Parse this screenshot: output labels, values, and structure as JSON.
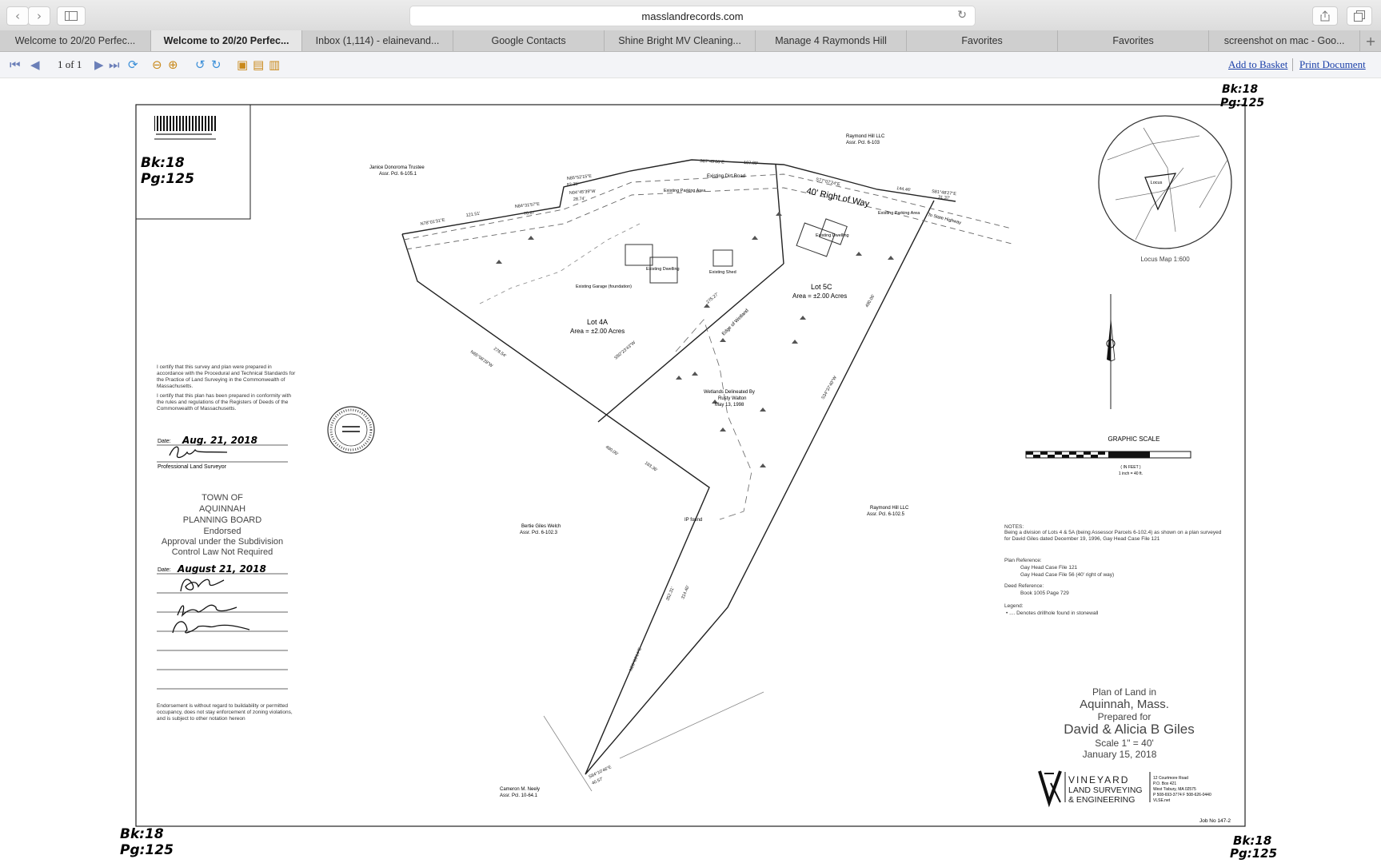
{
  "browser": {
    "url": "masslandrecords.com",
    "tabs": [
      {
        "label": "Welcome to 20/20 Perfec...",
        "active": false
      },
      {
        "label": "Welcome to 20/20 Perfec...",
        "active": true
      },
      {
        "label": "Inbox (1,114) - elainevand...",
        "active": false
      },
      {
        "label": "Google Contacts",
        "active": false
      },
      {
        "label": "Shine Bright MV Cleaning...",
        "active": false
      },
      {
        "label": "Manage 4 Raymonds Hill",
        "active": false
      },
      {
        "label": "Favorites",
        "active": false
      },
      {
        "label": "Favorites",
        "active": false
      },
      {
        "label": "screenshot on mac - Goo...",
        "active": false
      }
    ],
    "new_tab": "+"
  },
  "viewer": {
    "page_indicator": "1 of 1",
    "add_to_basket": "Add to Basket",
    "print_document": "Print Document"
  },
  "plan": {
    "stamps": {
      "top_right": [
        "Bk:18",
        "Pg:125"
      ],
      "title_block": [
        "Bk:18",
        "Pg:125"
      ],
      "bottom_left": [
        "Bk:18",
        "Pg:125"
      ],
      "bottom_right": [
        "Bk:18",
        "Pg:125"
      ]
    },
    "lots": {
      "lot4a_name": "Lot 4A",
      "lot4a_area": "Area = ±2.00 Acres",
      "lot5c_name": "Lot 5C",
      "lot5c_area": "Area = ±2.00 Acres"
    },
    "labels": {
      "right_of_way": "40' Right of Way",
      "dirt_road": "Existing Dirt Road",
      "state_highway": "To State Highway",
      "janice": "Janice Donoroma Trustee",
      "janice_parcel": "Assr. Pcl. 6-105.1",
      "raymond_top": "Raymond Hill LLC",
      "raymond_top_parcel": "Assr. Pcl. 6-103",
      "raymond_right": "Raymond Hill LLC",
      "raymond_right_parcel": "Assr. Pcl. 6-102.5",
      "bertie": "Bertie Giles Welch",
      "bertie_parcel": "Assr. Pcl. 6-102.3",
      "cameron": "Cameron M. Neely",
      "cameron_parcel": "Assr. Pcl. 10-64.1",
      "wetlands": "Wetlands Delineated By",
      "wetlands2": "Rusty Walton",
      "wetlands3": "May 13, 1998",
      "existing_dwelling": "Existing Dwelling",
      "existing_garage": "Existing Garage (foundation)",
      "existing_shed": "Existing Shed",
      "parking": "Existing Parking Area",
      "ip_found": "IP found",
      "edge_wetlands": "Edge of Wetland"
    },
    "certification": {
      "cert1": "I certify that this survey and plan were prepared in accordance with the Procedural and Technical Standards for the Practice of Land Surveying in the Commonwealth of Massachusetts.",
      "cert2": "I certify that this plan has been prepared in conformity with the rules and regulations of the Registers of Deeds of the Commonwealth of Massachusetts.",
      "date_label": "Date:",
      "date_value": "Aug. 21, 2018",
      "surveyor_label": "Professional Land Surveyor"
    },
    "planning_board": {
      "lines": [
        "TOWN OF",
        "AQUINNAH",
        "PLANNING BOARD",
        "Endorsed",
        "Approval under the Subdivision",
        "Control Law Not Required"
      ],
      "date_label": "Date:",
      "date_value": "August 21, 2018",
      "endorsement_note": "Endorsement is without regard to buildability or permitted occupancy, does not stay enforcement of zoning violations, and is subject to other notation hereon"
    },
    "locus": {
      "label": "Locus Map   1:600",
      "inner": "Locus"
    },
    "graphic_scale": {
      "title": "GRAPHIC SCALE",
      "sub1": "( IN FEET )",
      "sub2": "1 inch = 40 ft."
    },
    "notes": {
      "heading": "NOTES:",
      "text": "Being a division of Lots 4 & 5A (being Assessor Parcels 6-102.4) as shown on a plan surveyed for David Giles dated December 19, 1996, Gay Head Case File 121",
      "plan_ref": "Plan Reference:",
      "plan_ref1": "Gay Head Case File 121",
      "plan_ref2": "Gay Head Case File 56 (40' right of way)",
      "deed_ref": "Deed Reference:",
      "deed_ref1": "Book 1005 Page 729",
      "legend": "Legend:",
      "legend1": "• .... Denotes drillhole found in stonewall"
    },
    "title_block": {
      "line1": "Plan of Land in",
      "line2": "Aquinnah, Mass.",
      "line3": "Prepared for",
      "line4": "David & Alicia B Giles",
      "line5": "Scale 1\" = 40'",
      "line6": "January 15, 2018"
    },
    "firm": {
      "name1": "VINEYARD",
      "name2": "LAND SURVEYING",
      "name3": "& ENGINEERING",
      "address1": "12 Courtmore Road",
      "address2": "P.O. Box 421",
      "address3": "West Tisbury, MA 02575",
      "address4": "P 508-693-3774  F 508-626-0440",
      "address5": "VLSE.net"
    },
    "job_no": "Job No 147-2",
    "bearings": [
      "N78°01'31\"E",
      "121.51'",
      "N84°31'57\"E",
      "76.67'",
      "N85°52'15\"E",
      "82.35'",
      "N04°45'39\"W",
      "28.74'",
      "S87°49'06\"E",
      "107.89'",
      "S77°07'24\"E",
      "144.46'",
      "S81°48'27\"E",
      "31.37'",
      "N65°08'28\"W",
      "278.54'",
      "S50°23'43\"W",
      "275.27'",
      "480.00'",
      "183.36'",
      "S34°37'40\"W",
      "490.06'",
      "N20°03'14\"E",
      "352.31'",
      "314.40'",
      "S84°10'46\"E",
      "40.57'"
    ]
  }
}
